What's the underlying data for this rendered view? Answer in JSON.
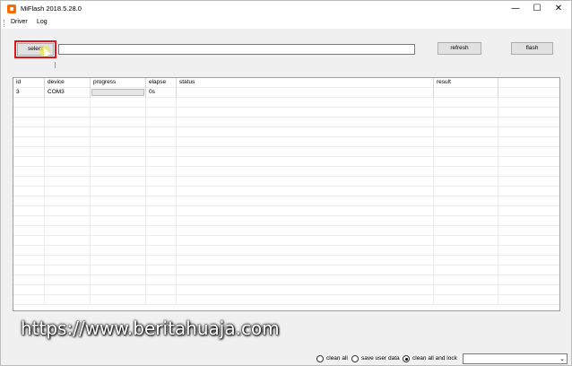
{
  "window": {
    "title": "MiFlash 2018.5.28.0",
    "min_glyph": "—",
    "max_glyph": "☐",
    "close_glyph": "✕"
  },
  "menu": {
    "items": [
      "Driver",
      "Log"
    ]
  },
  "toolbar": {
    "select_label": "select",
    "path_value": "",
    "refresh_label": "refresh",
    "flash_label": "flash"
  },
  "grid": {
    "columns": [
      "id",
      "device",
      "progress",
      "elapse",
      "status",
      "result",
      ""
    ],
    "rows": [
      {
        "id": "3",
        "device": "COM3",
        "progress": 0,
        "elapse": "0s",
        "status": "",
        "result": ""
      }
    ],
    "empty_row_count": 21
  },
  "watermark": "https://www.beritahuaja.com",
  "options": {
    "radios": [
      {
        "label": "clean all",
        "checked": false
      },
      {
        "label": "save user data",
        "checked": false
      },
      {
        "label": "clean all and lock",
        "checked": true
      }
    ],
    "mode_select_value": ""
  },
  "colors": {
    "highlight_box": "#e0141e",
    "app_icon": "#ff6a00"
  },
  "icons": {
    "app": "miflash-app-icon",
    "cursor": "mouse-cursor-icon"
  }
}
